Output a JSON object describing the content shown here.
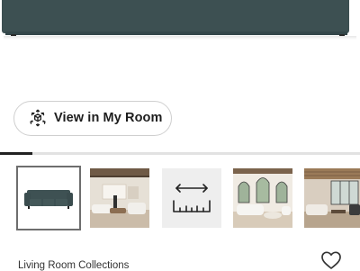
{
  "hero": {
    "product_color": "#3d5052"
  },
  "room_button": {
    "label": "View in My Room",
    "icon": "ar-cube-icon"
  },
  "carousel": {
    "progress": 0.09,
    "thumbnails": [
      {
        "name": "sofa-front-view",
        "selected": true
      },
      {
        "name": "living-room-scene-1",
        "selected": false
      },
      {
        "name": "dimensions",
        "icon": "ruler-icon",
        "selected": false
      },
      {
        "name": "living-room-scene-2",
        "selected": false
      },
      {
        "name": "living-room-scene-3",
        "selected": false
      }
    ]
  },
  "footer": {
    "collection_label": "Living Room Collections",
    "favorite_icon": "heart-icon"
  }
}
